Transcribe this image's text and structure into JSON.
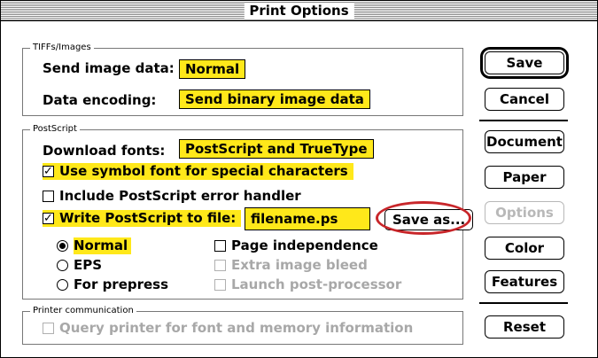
{
  "window": {
    "title": "Print Options"
  },
  "tiff": {
    "legend": "TIFFs/Images",
    "send_label": "Send image data:",
    "send_value": "Normal",
    "encoding_label": "Data encoding:",
    "encoding_value": "Send binary image data"
  },
  "postscript": {
    "legend": "PostScript",
    "fonts_label": "Download fonts:",
    "fonts_value": "PostScript and TrueType",
    "symbol_font": "Use symbol font for special characters",
    "error_handler": "Include PostScript error handler",
    "write_to_file": "Write PostScript to file:",
    "filename": "filename.ps",
    "save_as": "Save as...",
    "radio_normal": "Normal",
    "radio_eps": "EPS",
    "radio_prepress": "For prepress",
    "page_independence": "Page independence",
    "extra_bleed": "Extra image bleed",
    "launch_post": "Launch post-processor"
  },
  "printer": {
    "legend": "Printer communication",
    "query": "Query printer for font and memory information"
  },
  "buttons": {
    "save": "Save",
    "cancel": "Cancel",
    "document": "Document",
    "paper": "Paper",
    "options": "Options",
    "color": "Color",
    "features": "Features",
    "reset": "Reset"
  },
  "colors": {
    "highlight": "#ffe81a",
    "annotation": "#c8262a",
    "disabled": "#a8a8a8"
  }
}
